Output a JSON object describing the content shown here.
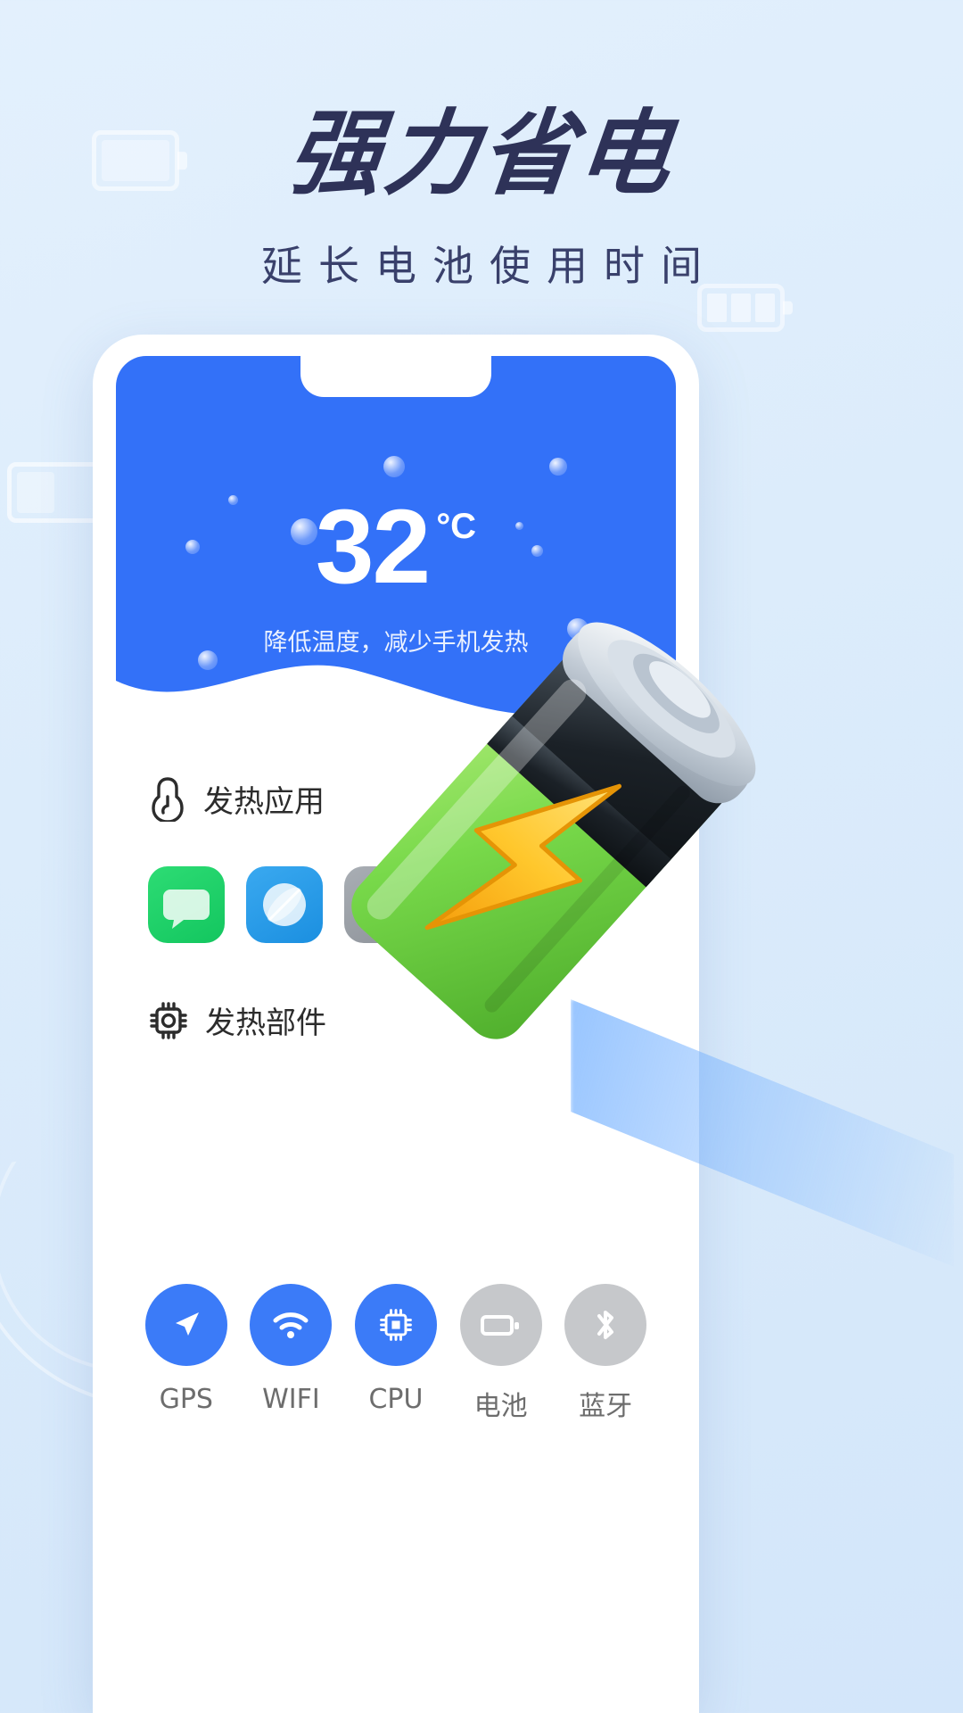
{
  "hero_banner": {
    "title": "强力省电",
    "subtitle": "延长电池使用时间",
    "title_color": "#2e3258",
    "subtitle_color": "#39406b",
    "background_color": "#e0edfc"
  },
  "decor": {
    "battery_top_left": "battery-outline-icon",
    "battery_right": "battery-bars-icon",
    "battery_left": "battery-half-icon"
  },
  "phone": {
    "frame_color": "#ffffff",
    "header": {
      "background_color": "#3371f8",
      "temperature": "32",
      "unit": "°C",
      "description": "降低温度，减少手机发热"
    },
    "sections": [
      {
        "id": "hot-apps",
        "icon": "thermometer-icon",
        "label": "发热应用",
        "apps": [
          {
            "name": "messages-app-icon",
            "color": "#22c55e"
          },
          {
            "name": "browser-app-icon",
            "color": "#2196f3"
          },
          {
            "name": "mail-app-icon",
            "color": "#9aa0a6"
          },
          {
            "name": "video-app-icon",
            "color": "#e0564f"
          }
        ]
      },
      {
        "id": "hot-components",
        "icon": "cpu-chip-icon",
        "label": "发热部件",
        "components": [
          {
            "label": "GPS",
            "icon": "location-arrow-icon",
            "active": true,
            "color": "#3b7bf8"
          },
          {
            "label": "WIFI",
            "icon": "wifi-icon",
            "active": true,
            "color": "#3b7bf8"
          },
          {
            "label": "CPU",
            "icon": "cpu-chip-icon",
            "active": true,
            "color": "#3b7bf8"
          },
          {
            "label": "电池",
            "icon": "battery-icon",
            "active": false,
            "color": "#c6c8cb"
          },
          {
            "label": "蓝牙",
            "icon": "bluetooth-icon",
            "active": false,
            "color": "#c6c8cb"
          }
        ]
      }
    ]
  },
  "artwork": {
    "name": "charging-battery-illustration",
    "body_color": "#7ddc52",
    "cap_color": "#c9d2dc",
    "bolt_color": "#ffd23f",
    "band_color": "#1a1f24"
  }
}
